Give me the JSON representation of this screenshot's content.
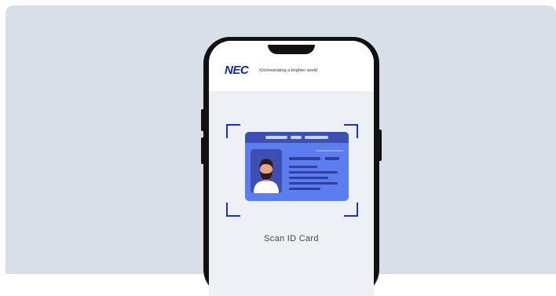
{
  "brand": {
    "logo_text": "NEC",
    "tagline": "\\Orchestrating a brighter world"
  },
  "scan": {
    "label": "Scan ID Card"
  },
  "colors": {
    "background_panel": "#d9dfe8",
    "brand_blue": "#14279b",
    "frame_blue": "#1e2fb8",
    "card_blue": "#5b7df0",
    "card_dark": "#3e4fb2"
  },
  "icons": [
    "id-card-illustration",
    "avatar-illustration",
    "scan-frame-corners"
  ]
}
